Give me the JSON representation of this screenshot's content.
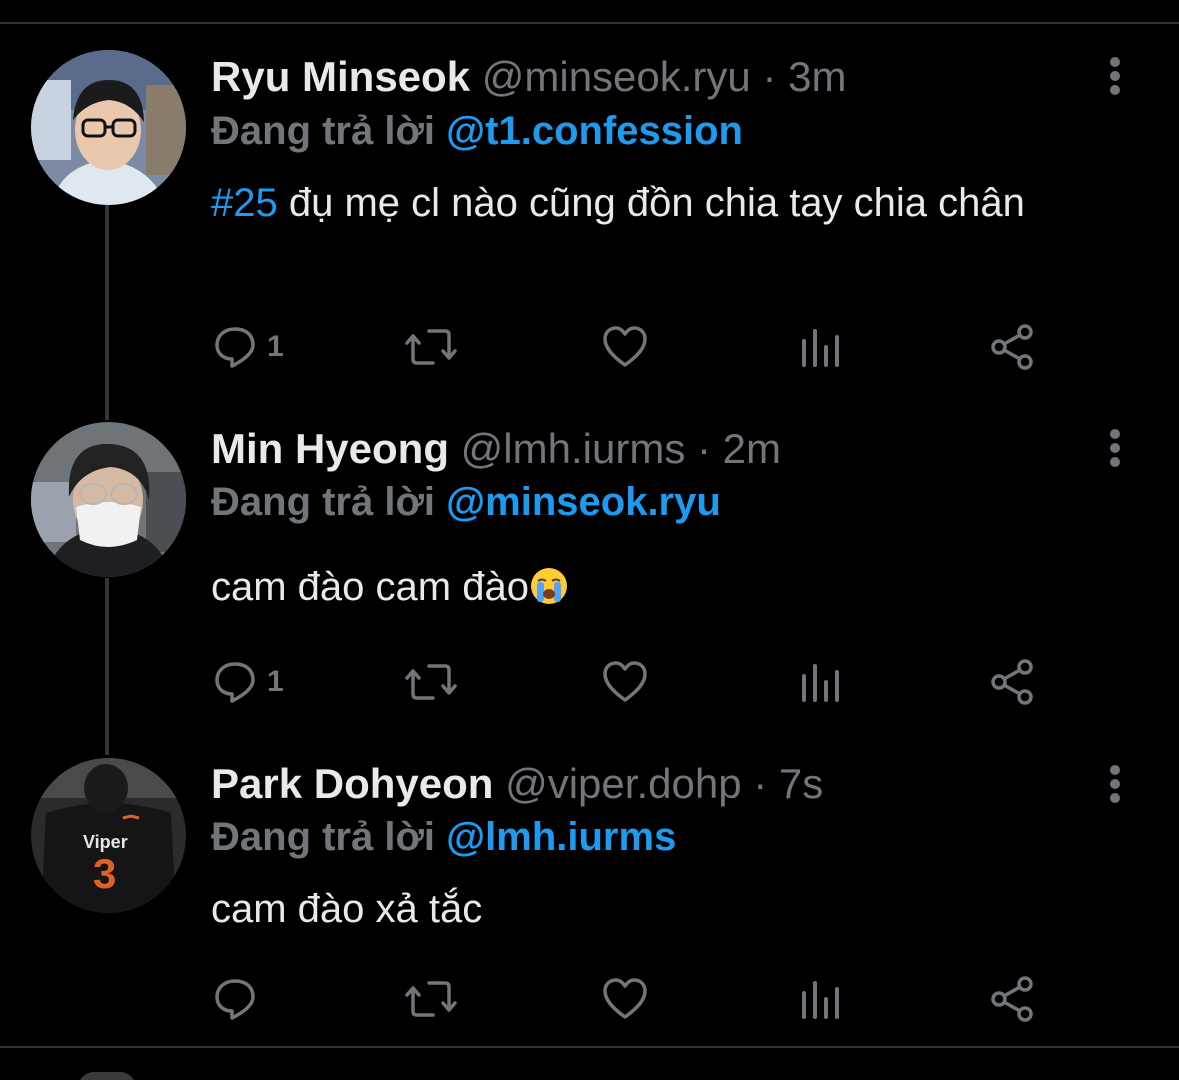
{
  "tweets": [
    {
      "name": "Ryu Minseok",
      "handle": "@minseok.ryu",
      "dot": "·",
      "time": "3m",
      "replying_prefix": "Đang trả lời",
      "replying_to": "@t1.confession",
      "hashtag": "#25",
      "text": " đụ mẹ cl nào cũng đồn chia tay chia chân",
      "reply_count": "1",
      "avatar_icon": "profile-photo"
    },
    {
      "name": "Min Hyeong",
      "handle": "@lmh.iurms",
      "dot": "·",
      "time": "2m",
      "replying_prefix": "Đang trả lời",
      "replying_to": "@minseok.ryu",
      "text": "cam đào cam đào",
      "emoji": "loudly-crying-face",
      "reply_count": "1",
      "avatar_icon": "profile-photo"
    },
    {
      "name": "Park Dohyeon",
      "handle": "@viper.dohp",
      "dot": "·",
      "time": "7s",
      "replying_prefix": "Đang trả lời",
      "replying_to": "@lmh.iurms",
      "text": "cam đào xả tắc",
      "reply_count": "",
      "avatar_icon": "profile-photo",
      "jersey_text": "Viper",
      "jersey_number": "3"
    }
  ],
  "colors": {
    "background": "#000000",
    "text": "#e7e9ea",
    "muted": "#71767b",
    "accent": "#1d9bf0",
    "divider": "#2f3336"
  },
  "icons": [
    "reply-icon",
    "retweet-icon",
    "like-icon",
    "views-icon",
    "share-icon",
    "more-icon"
  ]
}
